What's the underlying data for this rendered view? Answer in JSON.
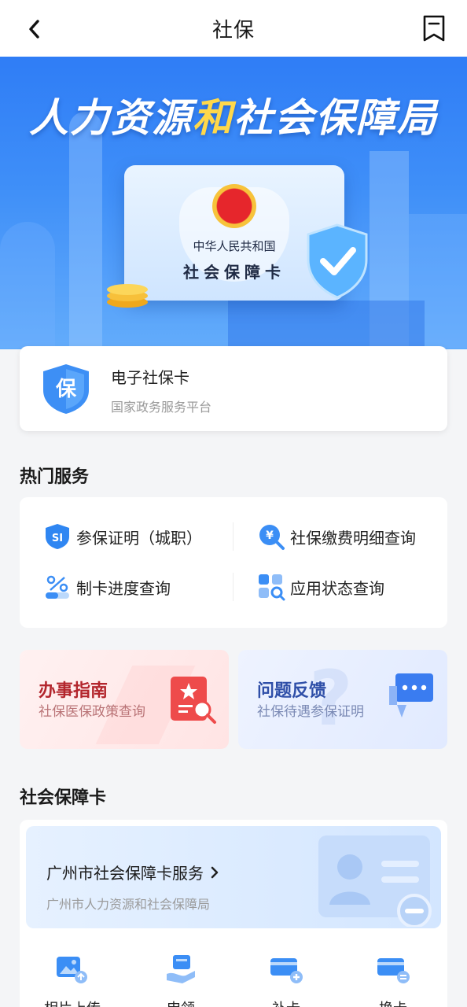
{
  "header": {
    "title": "社保"
  },
  "banner": {
    "title_part1": "人力资源",
    "title_highlight": "和",
    "title_part2": "社会保障局",
    "card_line1": "中华人民共和国",
    "card_line2": "社会保障卡"
  },
  "ecard": {
    "icon_char": "保",
    "title": "电子社保卡",
    "subtitle": "国家政务服务平台"
  },
  "hot": {
    "title": "热门服务",
    "items": [
      {
        "label": "参保证明（城职）",
        "icon": "si-shield-icon"
      },
      {
        "label": "社保缴费明细查询",
        "icon": "yuan-search-icon"
      },
      {
        "label": "制卡进度查询",
        "icon": "progress-icon"
      },
      {
        "label": "应用状态查询",
        "icon": "apps-search-icon"
      }
    ]
  },
  "tiles": [
    {
      "title": "办事指南",
      "subtitle": "社保医保政策查询",
      "title_color": "#b3262d",
      "sub_color": "#b97376"
    },
    {
      "title": "问题反馈",
      "subtitle": "社保待遇参保证明",
      "title_color": "#2f4fa8",
      "sub_color": "#7a89b4"
    }
  ],
  "card_section": {
    "title": "社会保障卡",
    "banner_title": "广州市社会保障卡服务",
    "banner_subtitle": "广州市人力资源和社会保障局",
    "items": [
      {
        "label": "相片上传",
        "icon": "photo-upload-icon"
      },
      {
        "label": "申领",
        "icon": "apply-icon"
      },
      {
        "label": "补卡",
        "icon": "card-add-icon"
      },
      {
        "label": "换卡",
        "icon": "card-swap-icon"
      }
    ]
  },
  "colors": {
    "accent": "#2f7df6",
    "highlight": "#ffd84a"
  }
}
